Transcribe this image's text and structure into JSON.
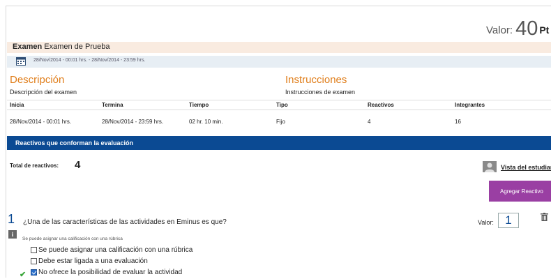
{
  "header": {
    "valor_label": "Valor:",
    "valor_value": "40",
    "pts_label": "Pt"
  },
  "exam": {
    "kind": "Examen",
    "name": "Examen de Prueba",
    "date_range": "28/Nov/2014 - 00:01 hrs. - 28/Nov/2014 - 23:59 hrs."
  },
  "description": {
    "title": "Descripción",
    "text": "Descripción del examen"
  },
  "instructions": {
    "title": "Instrucciones",
    "text": "Instrucciones de examen"
  },
  "info_table": {
    "headers": [
      "Inicia",
      "Termina",
      "Tiempo",
      "Tipo",
      "Reactivos",
      "Integrantes"
    ],
    "values": [
      "28/Nov/2014 - 00:01 hrs.",
      "28/Nov/2014 - 23:59 hrs.",
      "02 hr. 10 min.",
      "Fijo",
      "4",
      "16"
    ]
  },
  "section_bar": {
    "title": "Reactivos que conforman la evaluación"
  },
  "totals": {
    "label": "Total de reactivos:",
    "count": "4"
  },
  "student_view": {
    "label": "Vista del estudiant"
  },
  "add_button": {
    "label": "Agregar Reactivo"
  },
  "question": {
    "number": "1",
    "text": "¿Una de las características de las actividades en Eminus es que?",
    "valor_label": "Valor:",
    "valor_value": "1",
    "hint": "Se puede asignar una calificación con una rúbrica",
    "options": [
      {
        "label": "Se puede asignar una calificación con una rúbrica",
        "checked": false
      },
      {
        "label": "Debe estar ligada a una evaluación",
        "checked": false
      },
      {
        "label": "No ofrece la posibilidad de evaluar la actividad",
        "checked": true
      }
    ]
  },
  "icons": {
    "calendar": "calendar-icon",
    "student": "user-icon",
    "trash": "trash-icon",
    "info": "info-icon",
    "correct": "checkmark-icon"
  },
  "colors": {
    "orange_titles": "#e07e1b",
    "blue_bar": "#0b4a93",
    "purple_button": "#9a3fa3",
    "exam_bar_bg": "#f9ebe0",
    "date_bar_bg": "#e7eef4"
  }
}
